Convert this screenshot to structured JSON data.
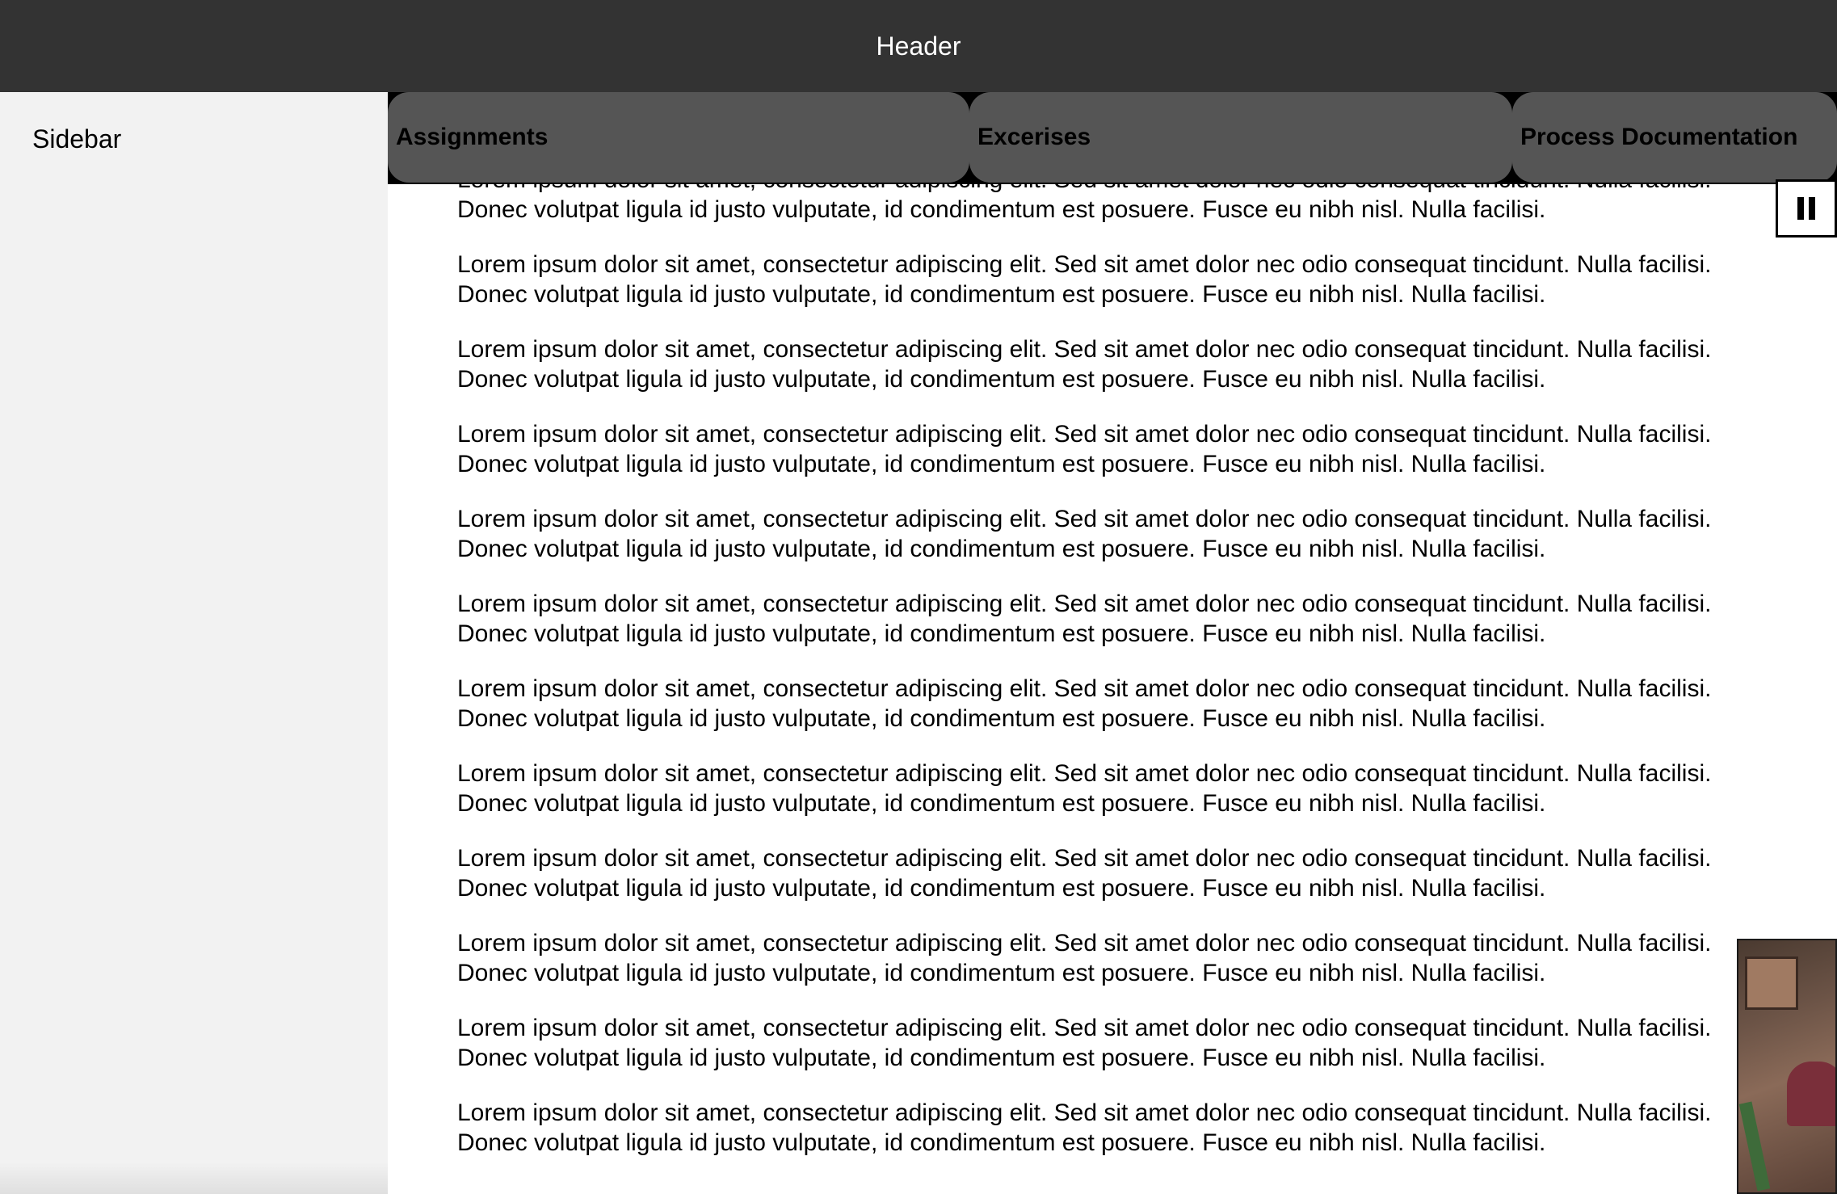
{
  "header": {
    "title": "Header"
  },
  "sidebar": {
    "title": "Sidebar"
  },
  "tabs": [
    {
      "label": "Assignments"
    },
    {
      "label": "Excerises"
    },
    {
      "label": "Process Documentation"
    }
  ],
  "content": {
    "paragraphs": [
      {
        "line1": "Lorem ipsum dolor sit amet, consectetur adipiscing elit. Sed sit amet dolor nec odio consequat tincidunt. Nulla facilisi.",
        "line2": "Donec volutpat ligula id justo vulputate, id condimentum est posuere. Fusce eu nibh nisl. Nulla facilisi."
      },
      {
        "line1": "Lorem ipsum dolor sit amet, consectetur adipiscing elit. Sed sit amet dolor nec odio consequat tincidunt. Nulla facilisi.",
        "line2": "Donec volutpat ligula id justo vulputate, id condimentum est posuere. Fusce eu nibh nisl. Nulla facilisi."
      },
      {
        "line1": "Lorem ipsum dolor sit amet, consectetur adipiscing elit. Sed sit amet dolor nec odio consequat tincidunt. Nulla facilisi.",
        "line2": "Donec volutpat ligula id justo vulputate, id condimentum est posuere. Fusce eu nibh nisl. Nulla facilisi."
      },
      {
        "line1": "Lorem ipsum dolor sit amet, consectetur adipiscing elit. Sed sit amet dolor nec odio consequat tincidunt. Nulla facilisi.",
        "line2": "Donec volutpat ligula id justo vulputate, id condimentum est posuere. Fusce eu nibh nisl. Nulla facilisi."
      },
      {
        "line1": "Lorem ipsum dolor sit amet, consectetur adipiscing elit. Sed sit amet dolor nec odio consequat tincidunt. Nulla facilisi.",
        "line2": "Donec volutpat ligula id justo vulputate, id condimentum est posuere. Fusce eu nibh nisl. Nulla facilisi."
      },
      {
        "line1": "Lorem ipsum dolor sit amet, consectetur adipiscing elit. Sed sit amet dolor nec odio consequat tincidunt. Nulla facilisi.",
        "line2": "Donec volutpat ligula id justo vulputate, id condimentum est posuere. Fusce eu nibh nisl. Nulla facilisi."
      },
      {
        "line1": "Lorem ipsum dolor sit amet, consectetur adipiscing elit. Sed sit amet dolor nec odio consequat tincidunt. Nulla facilisi.",
        "line2": "Donec volutpat ligula id justo vulputate, id condimentum est posuere. Fusce eu nibh nisl. Nulla facilisi."
      },
      {
        "line1": "Lorem ipsum dolor sit amet, consectetur adipiscing elit. Sed sit amet dolor nec odio consequat tincidunt. Nulla facilisi.",
        "line2": "Donec volutpat ligula id justo vulputate, id condimentum est posuere. Fusce eu nibh nisl. Nulla facilisi."
      },
      {
        "line1": "Lorem ipsum dolor sit amet, consectetur adipiscing elit. Sed sit amet dolor nec odio consequat tincidunt. Nulla facilisi.",
        "line2": "Donec volutpat ligula id justo vulputate, id condimentum est posuere. Fusce eu nibh nisl. Nulla facilisi."
      },
      {
        "line1": "Lorem ipsum dolor sit amet, consectetur adipiscing elit. Sed sit amet dolor nec odio consequat tincidunt. Nulla facilisi.",
        "line2": "Donec volutpat ligula id justo vulputate, id condimentum est posuere. Fusce eu nibh nisl. Nulla facilisi."
      },
      {
        "line1": "Lorem ipsum dolor sit amet, consectetur adipiscing elit. Sed sit amet dolor nec odio consequat tincidunt. Nulla facilisi.",
        "line2": "Donec volutpat ligula id justo vulputate, id condimentum est posuere. Fusce eu nibh nisl. Nulla facilisi."
      },
      {
        "line1": "Lorem ipsum dolor sit amet, consectetur adipiscing elit. Sed sit amet dolor nec odio consequat tincidunt. Nulla facilisi.",
        "line2": "Donec volutpat ligula id justo vulputate, id condimentum est posuere. Fusce eu nibh nisl. Nulla facilisi."
      }
    ]
  },
  "controls": {
    "pause_icon": "pause-icon"
  },
  "colors": {
    "header_bg": "#333333",
    "sidebar_bg": "#f2f2f2",
    "tab_bg": "#555555",
    "tabbar_bg": "#000000"
  }
}
